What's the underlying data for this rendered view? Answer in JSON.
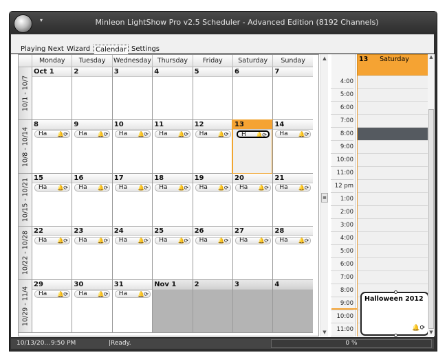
{
  "window": {
    "title": "Minleon LightShow Pro v2.5 Scheduler - Advanced Edition (8192 Channels)"
  },
  "menu": [
    {
      "label": "Playing Next"
    },
    {
      "label": "Wizard"
    },
    {
      "label": "Calendar",
      "active": true
    },
    {
      "label": "Settings"
    }
  ],
  "month_view": {
    "day_names": [
      "Monday",
      "Tuesday",
      "Wednesday",
      "Thursday",
      "Friday",
      "Saturday",
      "Sunday"
    ],
    "weeks": [
      {
        "label": "10/1 - 10/7",
        "days": [
          "Oct 1",
          "2",
          "3",
          "4",
          "5",
          "6",
          "7"
        ]
      },
      {
        "label": "10/8 - 10/14",
        "days": [
          "8",
          "9",
          "10",
          "11",
          "12",
          "13",
          "14"
        ]
      },
      {
        "label": "10/15 - 10/21",
        "days": [
          "15",
          "16",
          "17",
          "18",
          "19",
          "20",
          "21"
        ]
      },
      {
        "label": "10/22 - 10/28",
        "days": [
          "22",
          "23",
          "24",
          "25",
          "26",
          "27",
          "28"
        ]
      },
      {
        "label": "10/29 - 11/4",
        "days": [
          "29",
          "30",
          "31",
          "Nov 1",
          "2",
          "3",
          "4"
        ]
      }
    ],
    "appointment_label": "Ha",
    "selected_appointment_label": "H",
    "appointment_icons": "🔔⟳"
  },
  "day_view": {
    "date_number": "13",
    "day_name": "Saturday",
    "time_labels": [
      "4:00",
      "5:00",
      "6:00",
      "7:00",
      "8:00",
      "9:00",
      "10:00",
      "11:00",
      "12 pm",
      "1:00",
      "2:00",
      "3:00",
      "4:00",
      "5:00",
      "6:00",
      "7:00",
      "8:00",
      "9:00",
      "10:00",
      "11:00"
    ],
    "event": {
      "title": "Halloween 2012",
      "icons": "🔔⟳"
    }
  },
  "status": {
    "date": "10/13/20...",
    "time": "9:50 PM",
    "message": "|Ready.",
    "progress": "0 %"
  }
}
